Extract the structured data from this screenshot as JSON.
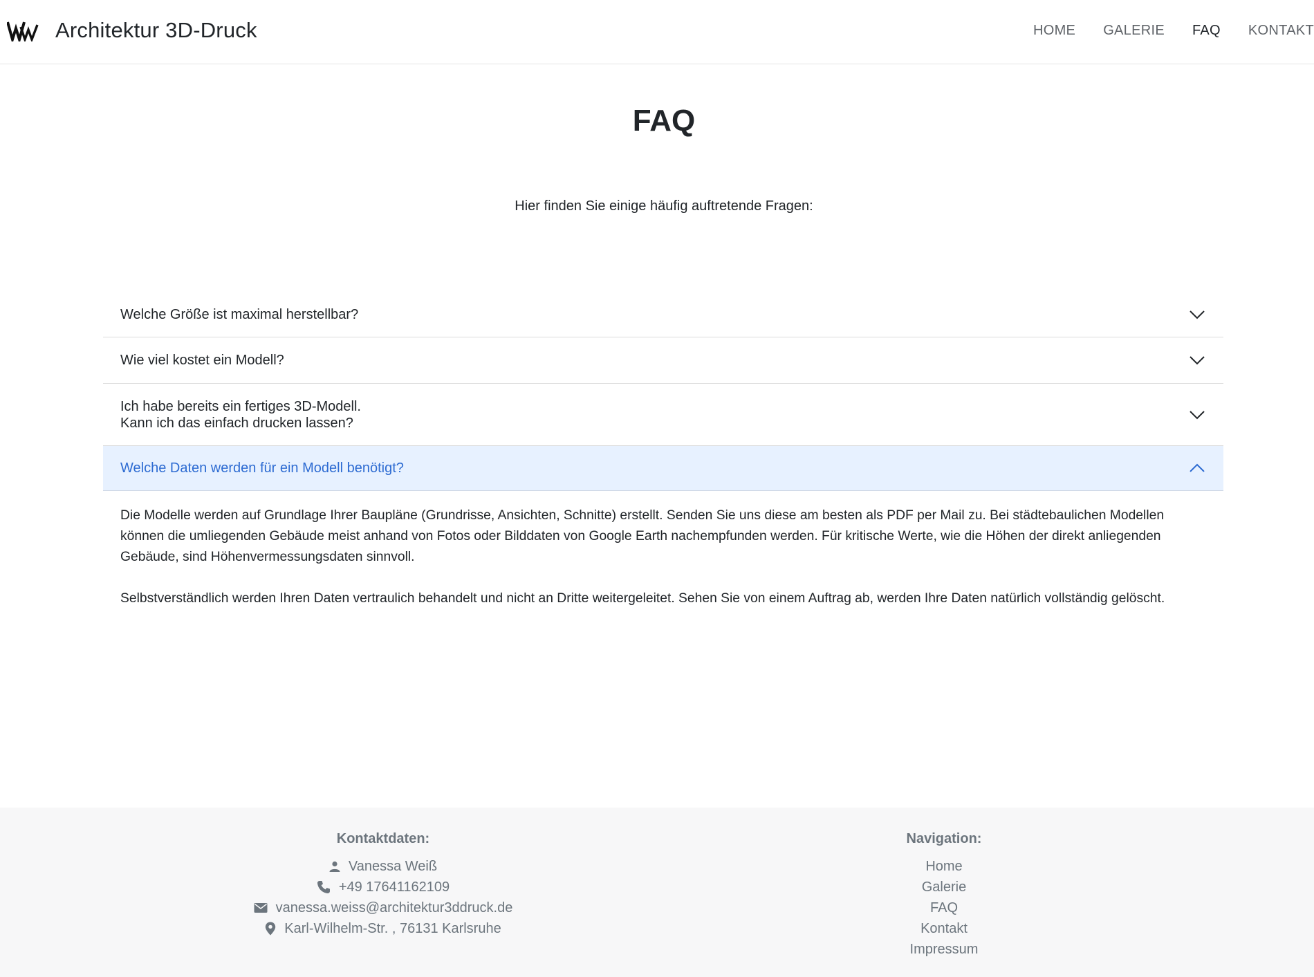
{
  "header": {
    "brand": "Architektur 3D-Druck",
    "nav": [
      {
        "label": "HOME",
        "active": false
      },
      {
        "label": "GALERIE",
        "active": false
      },
      {
        "label": "FAQ",
        "active": true
      },
      {
        "label": "KONTAKT",
        "active": false
      }
    ]
  },
  "main": {
    "title": "FAQ",
    "intro": "Hier finden Sie einige häufig auftretende Fragen:",
    "faq": [
      {
        "question_lines": [
          "Welche Größe ist maximal herstellbar?"
        ],
        "expanded": false
      },
      {
        "question_lines": [
          "Wie viel kostet ein Modell?"
        ],
        "expanded": false
      },
      {
        "question_lines": [
          "Ich habe bereits ein fertiges 3D-Modell.",
          "Kann ich das einfach drucken lassen?"
        ],
        "expanded": false
      },
      {
        "question_lines": [
          "Welche Daten werden für ein Modell benötigt?"
        ],
        "expanded": true,
        "answer_lines": [
          "Die Modelle werden auf Grundlage Ihrer Baupläne (Grundrisse, Ansichten, Schnitte) erstellt. Senden Sie uns diese am besten als PDF per Mail zu. Bei städtebaulichen Modellen",
          "können die umliegenden Gebäude meist anhand von Fotos oder Bilddaten von Google Earth nachempfunden werden. Für kritische Werte, wie die Höhen der direkt anliegenden",
          "Gebäude, sind Höhenvermessungsdaten sinnvoll."
        ],
        "answer_p2": "Selbstverständlich werden Ihren Daten vertraulich behandelt und nicht an Dritte weitergeleitet. Sehen Sie von einem Auftrag ab, werden Ihre Daten natürlich vollständig gelöscht."
      }
    ]
  },
  "footer": {
    "contact_heading": "Kontaktdaten:",
    "contact": {
      "name": "Vanessa Weiß",
      "phone": "+49 17641162109",
      "email": "vanessa.weiss@architektur3ddruck.de",
      "address": "Karl-Wilhelm-Str. , 76131 Karlsruhe"
    },
    "nav_heading": "Navigation:",
    "nav": [
      "Home",
      "Galerie",
      "FAQ",
      "Kontakt",
      "Impressum"
    ]
  },
  "colors": {
    "accent": "#2d6bd2",
    "expanded_bg": "#e7f1ff",
    "footer_bg": "#f7f7f8"
  },
  "icons": {
    "logo": "vw-logo-icon",
    "collapsed": "chevron-down-icon",
    "expanded": "chevron-up-icon",
    "name": "person-icon",
    "phone": "phone-icon",
    "email": "envelope-icon",
    "address": "map-pin-icon"
  }
}
